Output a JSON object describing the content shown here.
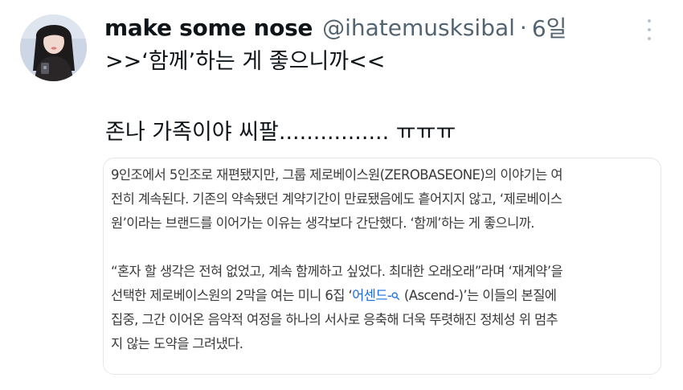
{
  "tweet": {
    "author": {
      "display_name": "make some nose",
      "handle": "@ihatemusksibal",
      "separator": "·",
      "time": "6일"
    },
    "text_line1": ">>‘함께’하는 게 좋으니까<<",
    "text_line2": "존나 가족이야 씨팔................ ㅠㅠㅠ"
  },
  "article": {
    "para1": [
      "9인조에서 5인조로 재편됐지만, 그룹 제로베이스원(ZEROBASEONE)의 이야기는 여",
      "전히 계속된다. 기존의 약속됐던 계약기간이 만료됐음에도 흩어지지 않고, ‘제로베이스",
      "원’이라는 브랜드를 이어가는 이유는 생각보다 간단했다. ‘함께’하는 게 좋으니까."
    ],
    "para2": {
      "line1": "“혼자 할 생각은 전혀 없었고, 계속 함께하고 싶었다. 최대한 오래오래”라며 ‘재계약’을",
      "line2_before": "선택한 제로베이스원의 2막을 여는 미니 6집 ‘",
      "line2_link": "어센드-",
      "line2_after": " (Ascend-)’는 이들의 본질에",
      "line3": "집중, 그간 이어온 음악적 여정을 하나의 서사로 응축해 더욱 뚜렷해진 정체성 위 멈추",
      "line4": "지 않는 도약을 그려냈다."
    }
  },
  "icons": {
    "avatar": "profile-photo",
    "more": "more-vertical-icon",
    "link": "search-link-icon"
  },
  "colors": {
    "secondary_text": "#536471",
    "link": "#1d6bd8",
    "card_border": "#e4e7ea"
  }
}
